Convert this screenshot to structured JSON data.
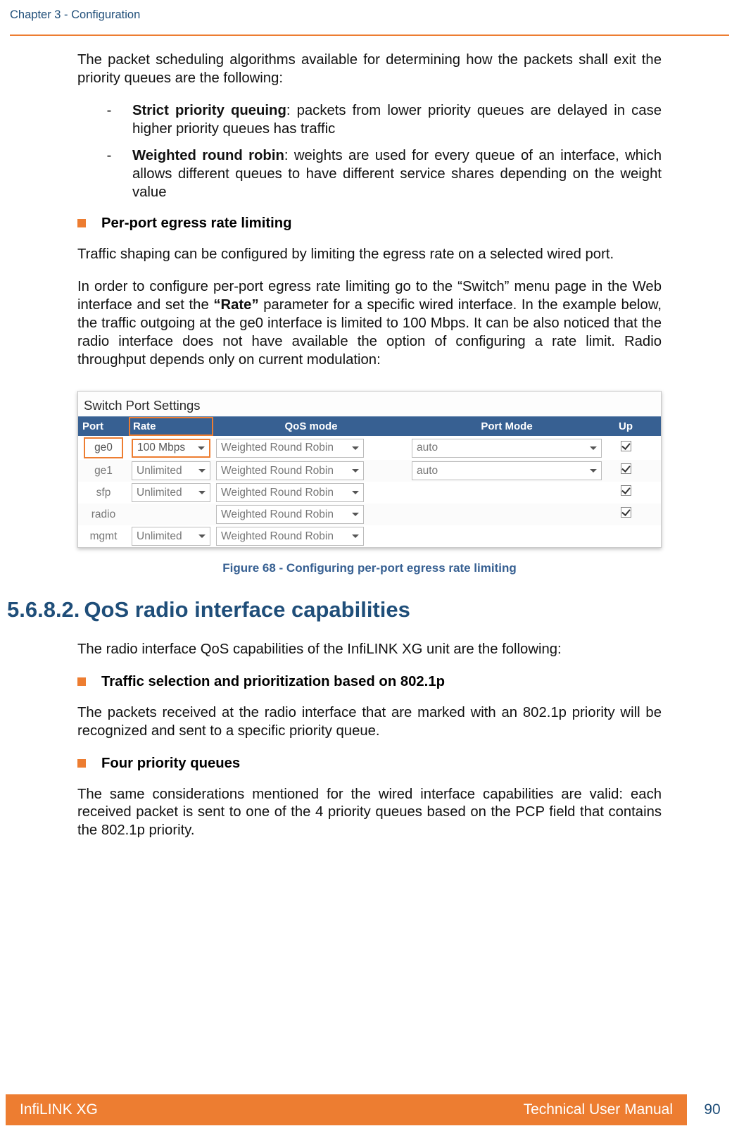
{
  "header": {
    "chapter": "Chapter 3 - Configuration"
  },
  "intro": "The packet scheduling algorithms available for determining how the packets shall exit the priority queues are the following:",
  "algo1": {
    "label": "Strict priority queuing",
    "rest": ": packets from lower priority queues are delayed in case higher priority queues has traffic"
  },
  "algo2": {
    "label": "Weighted round robin",
    "rest": ": weights are used for every queue of an interface, which allows  different queues to have different service shares depending on the weight value"
  },
  "rate_limit_title": "Per-port egress rate limiting",
  "rate_limit_p1": "Traffic shaping can be configured by limiting the egress rate on a selected wired port.",
  "rate_limit_p2a": "In order to configure per-port egress rate limiting go to the “Switch” menu page in the Web interface and set the ",
  "rate_limit_p2b": "“Rate”",
  "rate_limit_p2c": " parameter for a specific wired interface. In the example below, the traffic outgoing at the ge0 interface is limited to 100 Mbps. It can be also noticed that the radio interface does not have available the option of configuring a rate limit. Radio throughput depends only on current modulation:",
  "figure": {
    "panel_title": "Switch Port Settings",
    "headers": {
      "port": "Port",
      "rate": "Rate",
      "qos": "QoS mode",
      "mode": "Port Mode",
      "up": "Up"
    },
    "rows": [
      {
        "port": "ge0",
        "rate": "100 Mbps",
        "qos": "Weighted Round Robin",
        "mode": "auto",
        "up": true,
        "hl": true,
        "show_rate": true,
        "show_mode": true
      },
      {
        "port": "ge1",
        "rate": "Unlimited",
        "qos": "Weighted Round Robin",
        "mode": "auto",
        "up": true,
        "hl": false,
        "show_rate": true,
        "show_mode": true
      },
      {
        "port": "sfp",
        "rate": "Unlimited",
        "qos": "Weighted Round Robin",
        "mode": "",
        "up": true,
        "hl": false,
        "show_rate": true,
        "show_mode": false
      },
      {
        "port": "radio",
        "rate": "",
        "qos": "Weighted Round Robin",
        "mode": "",
        "up": true,
        "hl": false,
        "show_rate": false,
        "show_mode": false
      },
      {
        "port": "mgmt",
        "rate": "Unlimited",
        "qos": "Weighted Round Robin",
        "mode": "",
        "up": false,
        "hl": false,
        "show_rate": true,
        "show_mode": false
      }
    ],
    "caption": "Figure 68 - Configuring per-port egress rate limiting"
  },
  "section": {
    "number": "5.6.8.2.",
    "title": "QoS radio interface capabilities"
  },
  "radio_intro": "The radio interface QoS capabilities of the InfiLINK XG unit are the following:",
  "radio_b1_title": "Traffic selection and prioritization based on 802.1p",
  "radio_b1_text": "The packets received at the radio interface that are marked with an 802.1p priority will be recognized and sent to a specific priority queue.",
  "radio_b2_title": "Four priority queues",
  "radio_b2_text": "The same considerations mentioned for the wired interface capabilities are valid: each received packet is sent to one of the 4 priority queues based on the PCP field that contains the 802.1p priority.",
  "footer": {
    "left": "InfiLINK XG",
    "right": "Technical User Manual",
    "page": "90"
  }
}
